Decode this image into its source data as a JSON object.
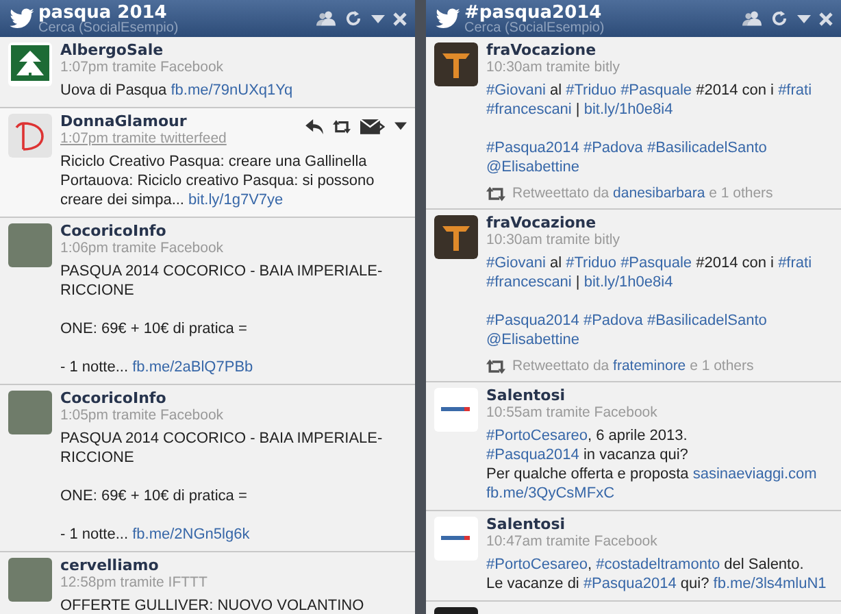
{
  "columns": [
    {
      "title": "pasqua 2014",
      "subtitle": "Cerca (SocialEsempio)",
      "tweets": [
        {
          "user": "AlbergoSale",
          "avatar": {
            "kind": "tree"
          },
          "time": "1:07pm tramite Facebook",
          "hovered": false,
          "paragraphs": [
            [
              [
                {
                  "text": "Uova di Pasqua ",
                  "link": false
                },
                {
                  "text": "fb.me/79nUXq1Yq",
                  "link": true
                }
              ]
            ]
          ]
        },
        {
          "user": "DonnaGlamour",
          "avatar": {
            "kind": "letter"
          },
          "time": "1:07pm tramite twitterfeed",
          "hovered": true,
          "paragraphs": [
            [
              [
                {
                  "text": "Riciclo Creativo Pasqua: creare una Gallinella",
                  "link": false
                }
              ],
              [
                {
                  "text": "Portauova: Riciclo creativo Pasqua: si possono",
                  "link": false
                }
              ],
              [
                {
                  "text": "creare dei simpa... ",
                  "link": false
                },
                {
                  "text": "bit.ly/1g7V7ye",
                  "link": true
                }
              ]
            ]
          ]
        },
        {
          "user": "CocoricoInfo",
          "avatar": {
            "kind": "photo"
          },
          "time": "1:06pm tramite Facebook",
          "hovered": false,
          "paragraphs": [
            [
              [
                {
                  "text": "PASQUA 2014 COCORICO - BAIA IMPERIALE-",
                  "link": false
                }
              ],
              [
                {
                  "text": "RICCIONE",
                  "link": false
                }
              ]
            ],
            [
              [
                {
                  "text": "ONE: 69€ + 10€ di pratica =",
                  "link": false
                }
              ]
            ],
            [
              [
                {
                  "text": "- 1 notte... ",
                  "link": false
                },
                {
                  "text": "fb.me/2aBlQ7PBb",
                  "link": true
                }
              ]
            ]
          ]
        },
        {
          "user": "CocoricoInfo",
          "avatar": {
            "kind": "photo"
          },
          "time": "1:05pm tramite Facebook",
          "hovered": false,
          "paragraphs": [
            [
              [
                {
                  "text": "PASQUA 2014 COCORICO - BAIA IMPERIALE-",
                  "link": false
                }
              ],
              [
                {
                  "text": "RICCIONE",
                  "link": false
                }
              ]
            ],
            [
              [
                {
                  "text": "ONE: 69€ + 10€ di pratica =",
                  "link": false
                }
              ]
            ],
            [
              [
                {
                  "text": "- 1 notte... ",
                  "link": false
                },
                {
                  "text": "fb.me/2NGn5lg6k",
                  "link": true
                }
              ]
            ]
          ]
        },
        {
          "user": "cervelliamo",
          "avatar": {
            "kind": "photo"
          },
          "time": "12:58pm tramite IFTTT",
          "hovered": false,
          "paragraphs": [
            [
              [
                {
                  "text": "OFFERTE GULLIVER: NUOVO VOLANTINO",
                  "link": false
                }
              ]
            ]
          ]
        }
      ]
    },
    {
      "title": "#pasqua2014",
      "subtitle": "Cerca (SocialEsempio)",
      "tweets": [
        {
          "user": "fraVocazione",
          "avatar": {
            "kind": "tau"
          },
          "time": "10:30am tramite bitly",
          "hovered": false,
          "paragraphs": [
            [
              [
                {
                  "text": "#Giovani",
                  "link": true
                },
                {
                  "text": " al ",
                  "link": false
                },
                {
                  "text": "#Triduo",
                  "link": true,
                  "space_after": true
                },
                {
                  "text": "#Pasquale",
                  "link": true
                },
                {
                  "text": " #2014 con i ",
                  "link": false
                },
                {
                  "text": "#frati",
                  "link": true
                }
              ],
              [
                {
                  "text": "#francescani",
                  "link": true
                },
                {
                  "text": " | ",
                  "link": false
                },
                {
                  "text": "bit.ly/1h0e8i4",
                  "link": true
                }
              ]
            ],
            [
              [
                {
                  "text": "#Pasqua2014",
                  "link": true,
                  "space_after": true
                },
                {
                  "text": "#Padova",
                  "link": true,
                  "space_after": true
                },
                {
                  "text": "#BasilicadelSanto",
                  "link": true
                }
              ],
              [
                {
                  "text": "@Elisabettine",
                  "link": true
                }
              ]
            ]
          ],
          "retweet": {
            "label": "Retweettato da ",
            "user": "danesibarbara",
            "rest": " e 1 others"
          }
        },
        {
          "user": "fraVocazione",
          "avatar": {
            "kind": "tau"
          },
          "time": "10:30am tramite bitly",
          "hovered": false,
          "paragraphs": [
            [
              [
                {
                  "text": "#Giovani",
                  "link": true
                },
                {
                  "text": " al ",
                  "link": false
                },
                {
                  "text": "#Triduo",
                  "link": true,
                  "space_after": true
                },
                {
                  "text": "#Pasquale",
                  "link": true
                },
                {
                  "text": " #2014 con i ",
                  "link": false
                },
                {
                  "text": "#frati",
                  "link": true
                }
              ],
              [
                {
                  "text": "#francescani",
                  "link": true
                },
                {
                  "text": " | ",
                  "link": false
                },
                {
                  "text": "bit.ly/1h0e8i4",
                  "link": true
                }
              ]
            ],
            [
              [
                {
                  "text": "#Pasqua2014",
                  "link": true,
                  "space_after": true
                },
                {
                  "text": "#Padova",
                  "link": true,
                  "space_after": true
                },
                {
                  "text": "#BasilicadelSanto",
                  "link": true
                }
              ],
              [
                {
                  "text": "@Elisabettine",
                  "link": true
                }
              ]
            ]
          ],
          "retweet": {
            "label": "Retweettato da ",
            "user": "frateminore",
            "rest": " e 1 others"
          }
        },
        {
          "user": "Salentosi",
          "avatar": {
            "kind": "wordmark"
          },
          "time": "10:55am tramite Facebook",
          "hovered": false,
          "paragraphs": [
            [
              [
                {
                  "text": "#PortoCesareo",
                  "link": true
                },
                {
                  "text": ", 6 aprile 2013.",
                  "link": false
                }
              ],
              [
                {
                  "text": "#Pasqua2014",
                  "link": true
                },
                {
                  "text": " in vacanza qui?",
                  "link": false
                }
              ],
              [
                {
                  "text": "Per qualche offerta e proposta ",
                  "link": false
                },
                {
                  "text": "sasinaeviaggi.com",
                  "link": true
                }
              ],
              [
                {
                  "text": "fb.me/3QyCsMFxC",
                  "link": true
                }
              ]
            ]
          ]
        },
        {
          "user": "Salentosi",
          "avatar": {
            "kind": "wordmark"
          },
          "time": "10:47am tramite Facebook",
          "hovered": false,
          "paragraphs": [
            [
              [
                {
                  "text": "#PortoCesareo",
                  "link": true
                },
                {
                  "text": ", ",
                  "link": false
                },
                {
                  "text": "#costadeltramonto",
                  "link": true
                },
                {
                  "text": " del Salento.",
                  "link": false
                }
              ],
              [
                {
                  "text": "Le vacanze di ",
                  "link": false
                },
                {
                  "text": "#Pasqua2014",
                  "link": true
                },
                {
                  "text": " qui? ",
                  "link": false
                },
                {
                  "text": "fb.me/3ls4mluN1",
                  "link": true
                }
              ]
            ]
          ]
        },
        {
          "avatar": {
            "kind": "dark"
          },
          "hovered": false
        }
      ]
    }
  ]
}
